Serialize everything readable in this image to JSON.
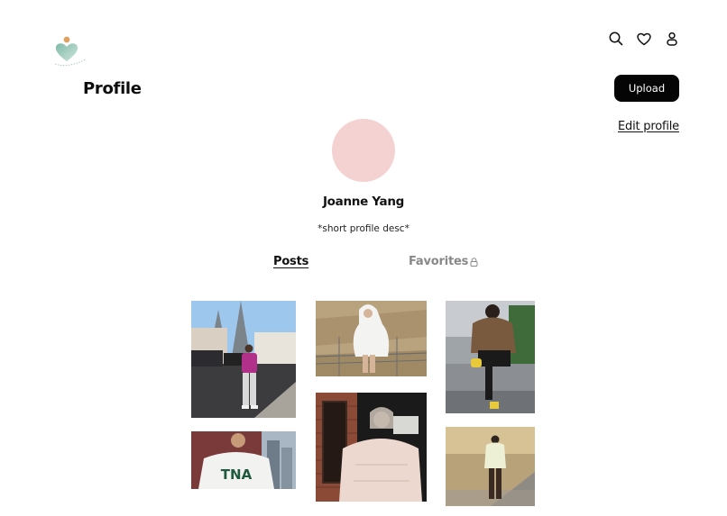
{
  "header": {
    "logo_icon": "heart-logo-icon",
    "title": "Profile",
    "icons": [
      "search-icon",
      "heart-icon",
      "user-icon"
    ],
    "upload_label": "Upload",
    "edit_profile_label": "Edit profile"
  },
  "profile": {
    "name": "Joanne Yang",
    "description": "*short profile desc*",
    "avatar_color": "#f5d2d2"
  },
  "tabs": {
    "posts_label": "Posts",
    "favorites_label": "Favorites",
    "favorites_icon": "lock-icon"
  },
  "colors": {
    "primary": "#050505",
    "background": "#ffffff",
    "muted_tab": "#888888",
    "logo_teal": "#8fc5b6",
    "logo_orange": "#e0a060"
  }
}
